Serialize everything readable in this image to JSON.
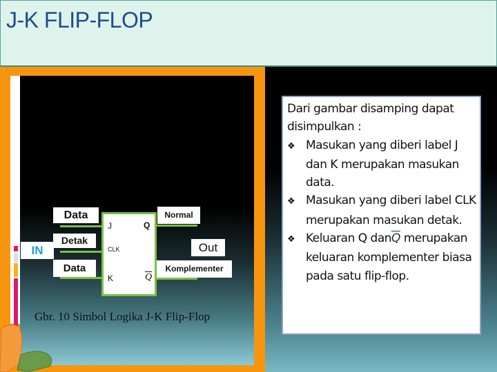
{
  "title": "J-K FLIP-FLOP",
  "diagram": {
    "input_label": "IN",
    "data_top": "Data",
    "detak": "Detak",
    "data_bottom": "Data",
    "normal": "Normal",
    "out": "Out",
    "komplementer": "Komplementer",
    "pins": {
      "j": "J",
      "q": "Q",
      "clk": "CLK",
      "k": "K",
      "qbar": "Q"
    },
    "caption": "Gbr. 10 Simbol Logika J-K Flip-Flop"
  },
  "note": {
    "intro": "Dari gambar disamping dapat disimpulkan :",
    "bullet_icon": "diamond-bullet-icon",
    "items": [
      "Masukan yang diberi label J dan K merupakan masukan data.",
      "Masukan yang diberi label CLK merupakan masukan detak."
    ],
    "item3_a": "Keluaran Q dan",
    "item3_q": "Q",
    "item3_b": " merupakan keluaran komplementer biasa pada satu flip-flop."
  },
  "colors": {
    "frame": "#f7950f",
    "title": "#1e4c8c",
    "wire": "#7ac143",
    "in": "#1aa5c8"
  }
}
